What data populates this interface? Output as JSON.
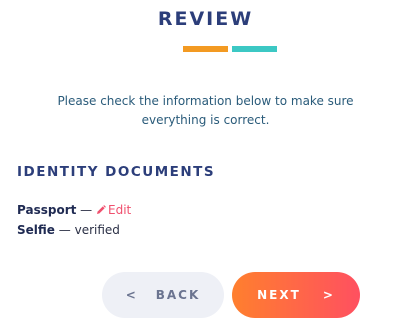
{
  "header": {
    "title": "REVIEW",
    "underline_colors": [
      "#f39a22",
      "#3cc8c4"
    ]
  },
  "intro": {
    "text": "Please check the information below to make sure everything is correct."
  },
  "identity_documents": {
    "heading": "IDENTITY DOCUMENTS",
    "items": [
      {
        "name": "Passport",
        "separator": "—",
        "action_label": "Edit",
        "action_icon": "pencil-icon"
      },
      {
        "name": "Selfie",
        "separator": "—",
        "status": "verified"
      }
    ]
  },
  "navigation": {
    "back_arrow": "<",
    "back_label": "BACK",
    "next_label": "NEXT",
    "next_arrow": ">"
  },
  "colors": {
    "title": "#2c3e7a",
    "edit": "#f0506e",
    "next_gradient_start": "#ff7f2e",
    "next_gradient_end": "#ff5060",
    "back_bg": "#eef0f6"
  }
}
